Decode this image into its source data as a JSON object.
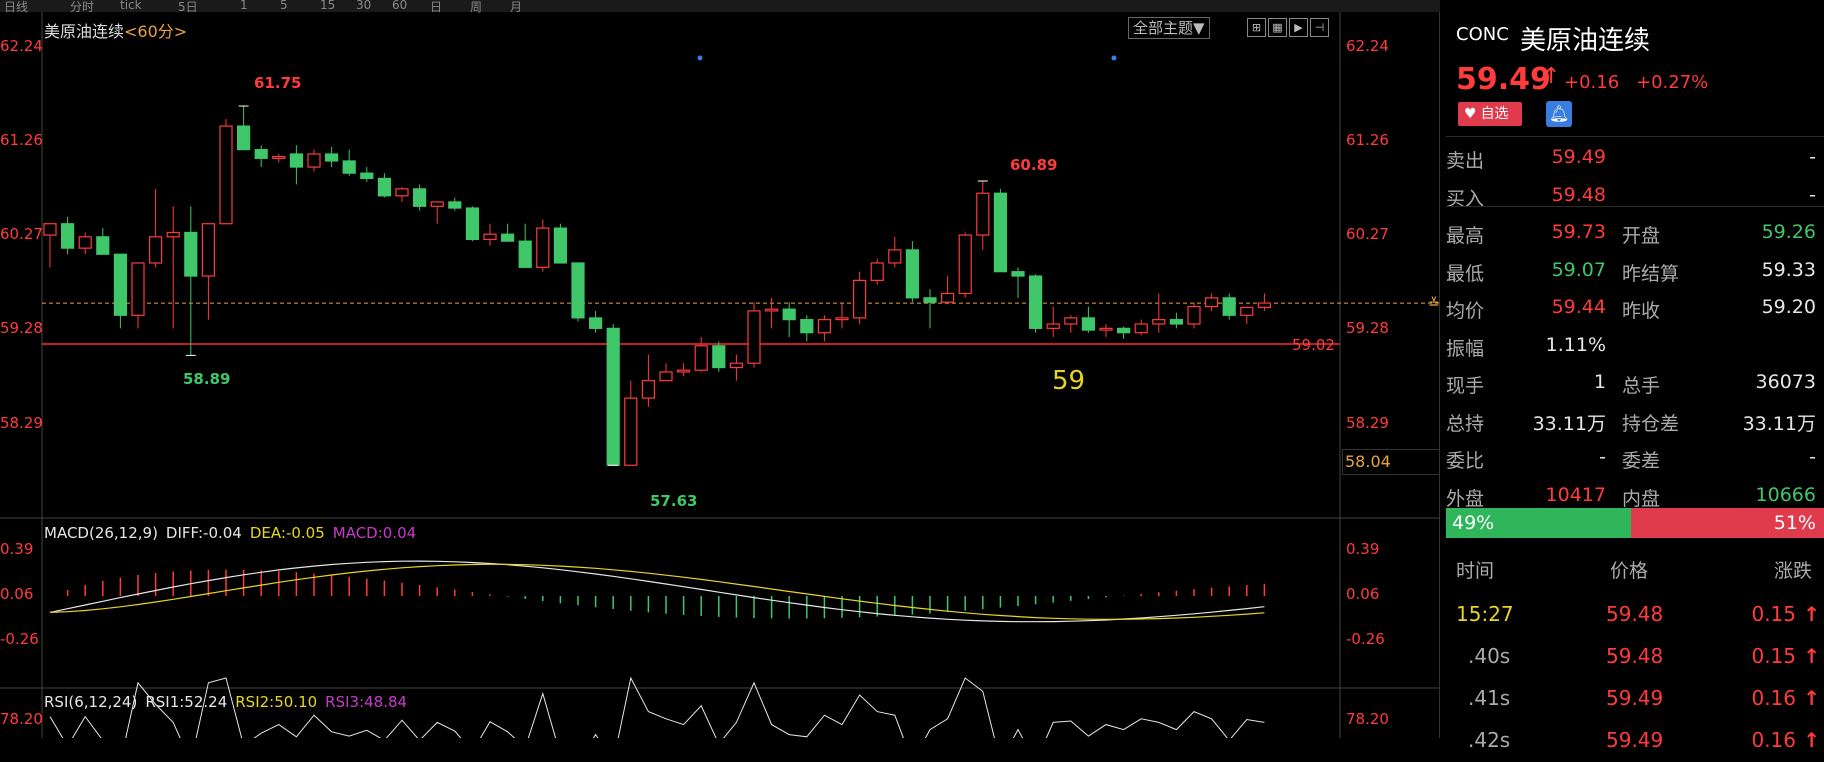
{
  "toolbar": {
    "items": [
      "日线",
      "分时",
      "tick",
      "5日",
      "1",
      "5",
      "15",
      "30",
      "60",
      "日",
      "周",
      "月"
    ]
  },
  "chart": {
    "symbol_title": "美原油连续",
    "period": "<60分>",
    "theme_button": "全部主题▼",
    "view_buttons": [
      "⊞",
      "▦",
      "▶",
      "⊣"
    ],
    "left_axis": [
      "62.24",
      "61.26",
      "60.27",
      "59.28",
      "58.29"
    ],
    "right_axis": [
      "62.24",
      "61.26",
      "60.27",
      "59.28",
      "58.29"
    ],
    "high_label": "61.75",
    "low_label_left": "58.89",
    "low_label_bottom": "57.63",
    "local_high_label": "60.89",
    "support_line_label": "59.02",
    "annotation_text": "59",
    "current_price_box": "58.04",
    "support_line_value": 59.02,
    "current_price_line_value": 59.49,
    "y_range": [
      57.3,
      62.45
    ],
    "colors": {
      "up": "#ff3b3b",
      "down": "#3fc76a",
      "ma_yellow": "#e8d520",
      "dash": "#e8a53c"
    },
    "candles": [
      [
        60.27,
        60.4,
        59.9,
        60.4
      ],
      [
        60.4,
        60.48,
        60.05,
        60.12
      ],
      [
        60.12,
        60.3,
        60.05,
        60.25
      ],
      [
        60.25,
        60.35,
        60.05,
        60.05
      ],
      [
        60.05,
        60.05,
        59.2,
        59.35
      ],
      [
        59.35,
        59.95,
        59.2,
        59.95
      ],
      [
        59.95,
        60.8,
        59.9,
        60.25
      ],
      [
        60.25,
        60.6,
        59.2,
        60.3
      ],
      [
        60.3,
        60.6,
        58.89,
        59.8
      ],
      [
        59.8,
        60.35,
        59.3,
        60.4
      ],
      [
        60.4,
        61.6,
        60.4,
        61.52
      ],
      [
        61.52,
        61.75,
        61.25,
        61.25
      ],
      [
        61.25,
        61.3,
        61.05,
        61.15
      ],
      [
        61.15,
        61.2,
        61.1,
        61.17
      ],
      [
        61.2,
        61.3,
        60.85,
        61.05
      ],
      [
        61.05,
        61.25,
        61.0,
        61.2
      ],
      [
        61.2,
        61.28,
        61.05,
        61.12
      ],
      [
        61.12,
        61.25,
        60.95,
        60.98
      ],
      [
        60.98,
        61.05,
        60.88,
        60.92
      ],
      [
        60.92,
        60.98,
        60.7,
        60.72
      ],
      [
        60.72,
        60.82,
        60.65,
        60.8
      ],
      [
        60.8,
        60.85,
        60.55,
        60.6
      ],
      [
        60.6,
        60.65,
        60.4,
        60.65
      ],
      [
        60.65,
        60.7,
        60.55,
        60.58
      ],
      [
        60.58,
        60.6,
        60.2,
        60.22
      ],
      [
        60.22,
        60.4,
        60.15,
        60.28
      ],
      [
        60.28,
        60.4,
        60.2,
        60.2
      ],
      [
        60.2,
        60.4,
        59.9,
        59.9
      ],
      [
        59.9,
        60.45,
        59.85,
        60.35
      ],
      [
        60.35,
        60.4,
        59.95,
        59.95
      ],
      [
        59.95,
        59.95,
        59.28,
        59.32
      ],
      [
        59.32,
        59.4,
        59.15,
        59.2
      ],
      [
        59.2,
        59.25,
        57.63,
        57.63
      ],
      [
        57.63,
        58.6,
        57.63,
        58.4
      ],
      [
        58.4,
        58.9,
        58.3,
        58.6
      ],
      [
        58.6,
        58.8,
        58.6,
        58.7
      ],
      [
        58.7,
        58.8,
        58.65,
        58.72
      ],
      [
        58.72,
        59.1,
        58.7,
        59.0
      ],
      [
        59.0,
        59.05,
        58.7,
        58.75
      ],
      [
        58.75,
        58.9,
        58.6,
        58.8
      ],
      [
        58.8,
        59.5,
        58.75,
        59.4
      ],
      [
        59.4,
        59.55,
        59.2,
        59.42
      ],
      [
        59.42,
        59.5,
        59.1,
        59.3
      ],
      [
        59.3,
        59.35,
        59.05,
        59.15
      ],
      [
        59.15,
        59.35,
        59.05,
        59.3
      ],
      [
        59.3,
        59.5,
        59.2,
        59.32
      ],
      [
        59.32,
        59.85,
        59.25,
        59.75
      ],
      [
        59.75,
        60.0,
        59.7,
        59.95
      ],
      [
        59.95,
        60.25,
        59.9,
        60.1
      ],
      [
        60.1,
        60.2,
        59.5,
        59.55
      ],
      [
        59.55,
        59.65,
        59.2,
        59.5
      ],
      [
        59.5,
        59.8,
        59.5,
        59.6
      ],
      [
        59.6,
        60.3,
        59.55,
        60.27
      ],
      [
        60.27,
        60.89,
        60.1,
        60.75
      ],
      [
        60.75,
        60.8,
        59.85,
        59.85
      ],
      [
        59.85,
        59.9,
        59.55,
        59.8
      ],
      [
        59.8,
        59.82,
        59.15,
        59.2
      ],
      [
        59.2,
        59.45,
        59.1,
        59.25
      ],
      [
        59.25,
        59.35,
        59.15,
        59.32
      ],
      [
        59.32,
        59.45,
        59.15,
        59.18
      ],
      [
        59.18,
        59.25,
        59.1,
        59.2
      ],
      [
        59.2,
        59.22,
        59.08,
        59.15
      ],
      [
        59.15,
        59.3,
        59.12,
        59.25
      ],
      [
        59.25,
        59.6,
        59.15,
        59.3
      ],
      [
        59.3,
        59.38,
        59.2,
        59.25
      ],
      [
        59.25,
        59.5,
        59.2,
        59.45
      ],
      [
        59.45,
        59.6,
        59.4,
        59.55
      ],
      [
        59.55,
        59.6,
        59.3,
        59.35
      ],
      [
        59.35,
        59.45,
        59.25,
        59.44
      ],
      [
        59.44,
        59.6,
        59.4,
        59.49
      ]
    ]
  },
  "macd": {
    "label": "MACD(26,12,9)",
    "diff": "DIFF:-0.04",
    "dea": "DEA:-0.05",
    "macd": "MACD:0.04",
    "axis": [
      "0.39",
      "0.06",
      "-0.26"
    ],
    "axis_right": [
      "0.39",
      "0.06",
      "-0.26"
    ]
  },
  "rsi": {
    "label": "RSI(6,12,24)",
    "rsi1": "RSI1:52.24",
    "rsi2": "RSI2:50.10",
    "rsi3": "RSI3:48.84",
    "axis_left": "78.20",
    "axis_right": "78.20"
  },
  "quote": {
    "code": "CONC",
    "name": "美原油连续",
    "price": "59.49",
    "arrow": "↑",
    "change": "+0.16",
    "pct": "+0.27%",
    "fav_label": "自选",
    "rows": [
      {
        "l1": "卖出",
        "v1": "59.49",
        "c1": "red",
        "l2": "",
        "v2": "-",
        "c2": "white"
      },
      {
        "l1": "买入",
        "v1": "59.48",
        "c1": "red",
        "l2": "",
        "v2": "-",
        "c2": "white"
      },
      {
        "l1": "最高",
        "v1": "59.73",
        "c1": "red",
        "l2": "开盘",
        "v2": "59.26",
        "c2": "green"
      },
      {
        "l1": "最低",
        "v1": "59.07",
        "c1": "green",
        "l2": "昨结算",
        "v2": "59.33",
        "c2": "white"
      },
      {
        "l1": "均价",
        "v1": "59.44",
        "c1": "red",
        "l2": "昨收",
        "v2": "59.20",
        "c2": "white"
      },
      {
        "l1": "振幅",
        "v1": "1.11%",
        "c1": "white",
        "l2": "",
        "v2": "",
        "c2": "white"
      },
      {
        "l1": "现手",
        "v1": "1",
        "c1": "white",
        "l2": "总手",
        "v2": "36073",
        "c2": "white"
      },
      {
        "l1": "总持",
        "v1": "33.11万",
        "c1": "white",
        "l2": "持仓差",
        "v2": "33.11万",
        "c2": "white"
      },
      {
        "l1": "委比",
        "v1": "-",
        "c1": "white",
        "l2": "委差",
        "v2": "-",
        "c2": "white"
      },
      {
        "l1": "外盘",
        "v1": "10417",
        "c1": "red",
        "l2": "内盘",
        "v2": "10666",
        "c2": "green"
      }
    ],
    "ratio_buy": "49%",
    "ratio_sell": "51%",
    "ratio_buy_fraction": 0.49,
    "tick_headers": [
      "时间",
      "价格",
      "涨跌"
    ],
    "ticks": [
      {
        "time": "15:27",
        "price": "59.48",
        "chg": "0.15",
        "arrow": "↑",
        "time_color": "yellow"
      },
      {
        "time": ".40s",
        "price": "59.48",
        "chg": "0.15",
        "arrow": "↑",
        "time_color": "gray"
      },
      {
        "time": ".41s",
        "price": "59.49",
        "chg": "0.16",
        "arrow": "↑",
        "time_color": "gray"
      },
      {
        "time": ".42s",
        "price": "59.49",
        "chg": "0.16",
        "arrow": "↑",
        "time_color": "gray"
      }
    ]
  }
}
